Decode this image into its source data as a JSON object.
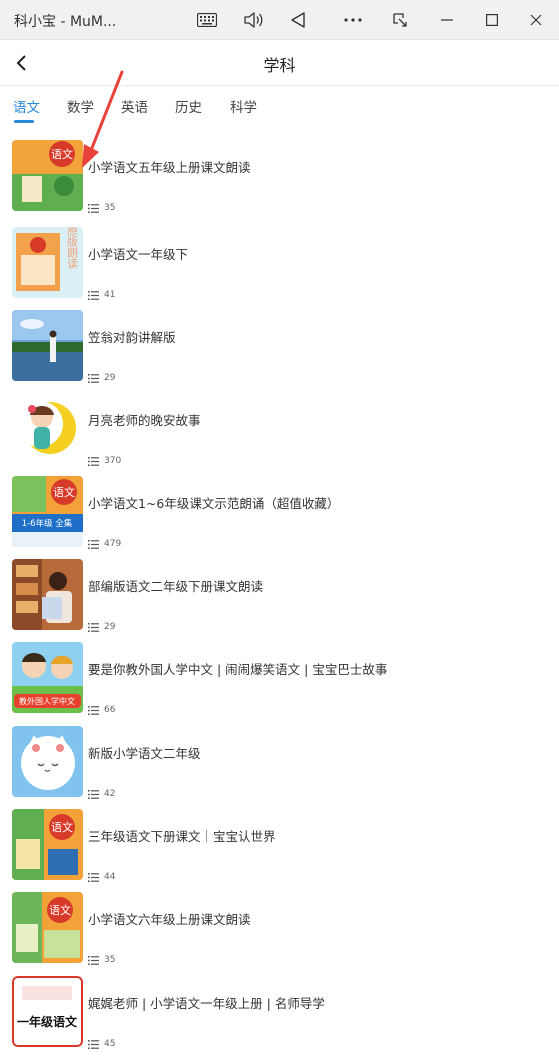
{
  "window": {
    "title": "科小宝 - MuM...",
    "controls": [
      "keyboard-icon",
      "volume-icon",
      "back-triangle-icon",
      "more-icon",
      "pin-icon",
      "minimize-icon",
      "maximize-icon",
      "close-icon"
    ]
  },
  "header": {
    "title": "学科"
  },
  "tabs": [
    {
      "label": "语文",
      "active": true
    },
    {
      "label": "数学",
      "active": false
    },
    {
      "label": "英语",
      "active": false
    },
    {
      "label": "历史",
      "active": false
    },
    {
      "label": "科学",
      "active": false
    }
  ],
  "colors": {
    "accent": "#2b8ad8",
    "annotation": "#e8413a"
  },
  "items": [
    {
      "title": "小学语文五年级上册课文朗读",
      "count": "35",
      "thumb_text": "语文"
    },
    {
      "title": "小学语文一年级下",
      "count": "41",
      "thumb_text": "原版朗读"
    },
    {
      "title": "笠翁对韵讲解版",
      "count": "29"
    },
    {
      "title": "月亮老师的晚安故事",
      "count": "370"
    },
    {
      "title": "小学语文1~6年级课文示范朗诵（超值收藏）",
      "count": "479",
      "thumb_text": "语文",
      "thumb_banner": "1-6年级 全集"
    },
    {
      "title": "部编版语文二年级下册课文朗读",
      "count": "29"
    },
    {
      "title": "要是你教外国人学中文 | 闹闹爆笑语文 | 宝宝巴士故事",
      "count": "66",
      "thumb_text": "教外国人学中文"
    },
    {
      "title": "新版小学语文二年级",
      "count": "42"
    },
    {
      "title": "三年级语文下册课文｜宝宝认世界",
      "count": "44",
      "thumb_text": "语文"
    },
    {
      "title": "小学语文六年级上册课文朗读",
      "count": "35",
      "thumb_text": "语文"
    },
    {
      "title": "娓娓老师 | 小学语文一年级上册 | 名师导学",
      "count": "45",
      "thumb_text": "一年级语文"
    }
  ]
}
